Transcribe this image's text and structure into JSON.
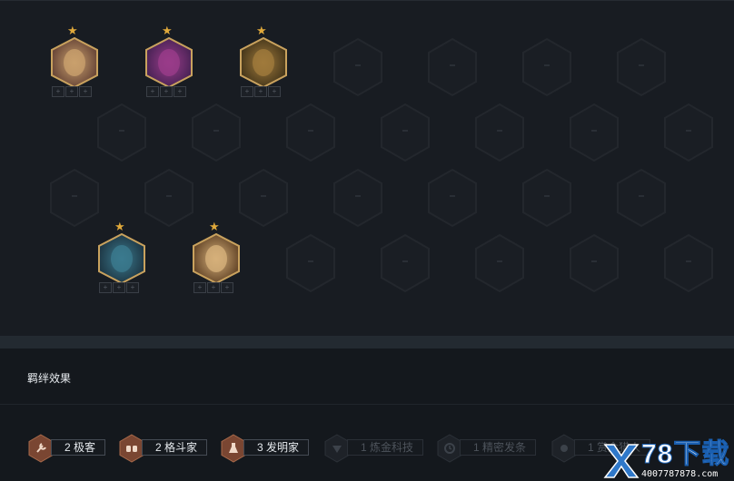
{
  "board": {
    "champions": [
      {
        "name": "champion-1",
        "stars": "★",
        "colors": [
          "#c9a06d",
          "#6d4a3a"
        ],
        "items": [
          "+",
          "+",
          "+"
        ]
      },
      {
        "name": "champion-2",
        "stars": "★",
        "colors": [
          "#9a3c8a",
          "#4d2458"
        ],
        "items": [
          "+",
          "+",
          "+"
        ]
      },
      {
        "name": "champion-3",
        "stars": "★",
        "colors": [
          "#a07a3c",
          "#4a3a1c"
        ],
        "items": [
          "+",
          "+",
          "+"
        ]
      },
      {
        "name": "champion-4",
        "stars": "★",
        "colors": [
          "#3b7a8e",
          "#1f3a48"
        ],
        "items": [
          "+",
          "+",
          "+"
        ]
      },
      {
        "name": "champion-5",
        "stars": "★",
        "colors": [
          "#d6b07a",
          "#6a4b2c"
        ],
        "items": [
          "+",
          "+",
          "+"
        ]
      }
    ]
  },
  "synergy": {
    "title": "羁绊效果",
    "traits": [
      {
        "label": "2 极客",
        "active": true,
        "icon": "wrench-icon"
      },
      {
        "label": "2 格斗家",
        "active": true,
        "icon": "fists-icon"
      },
      {
        "label": "3 发明家",
        "active": true,
        "icon": "flask-icon"
      },
      {
        "label": "1 炼金科技",
        "active": false,
        "icon": "chem-icon"
      },
      {
        "label": "1 精密发条",
        "active": false,
        "icon": "clock-icon"
      },
      {
        "label": "1 赏金猎人",
        "active": false,
        "icon": "target-icon"
      }
    ]
  },
  "watermark": {
    "logo_letter": "X",
    "brand": "78下载",
    "sub": "4007787878.com"
  }
}
